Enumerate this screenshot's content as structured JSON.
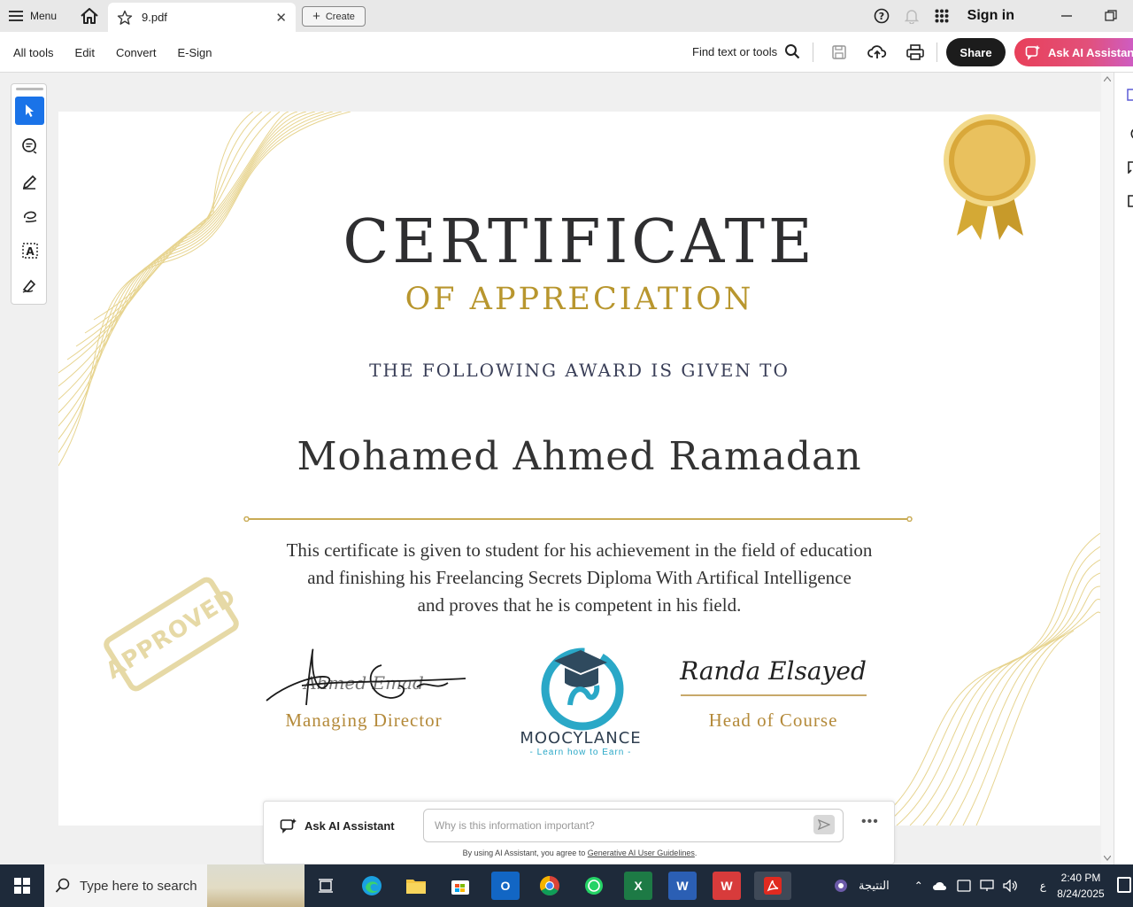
{
  "tabbar": {
    "menu_label": "Menu",
    "tab_title": "9.pdf",
    "create_label": "Create",
    "signin_label": "Sign in"
  },
  "toolbar": {
    "menu_items": [
      "All tools",
      "Edit",
      "Convert",
      "E-Sign"
    ],
    "find_label": "Find text or tools",
    "share_label": "Share",
    "ai_label": "Ask AI Assistant"
  },
  "certificate": {
    "title": "CERTIFICATE",
    "subtitle": "OF APPRECIATION",
    "given_to": "THE FOLLOWING AWARD IS GIVEN TO",
    "name": "Mohamed Ahmed Ramadan",
    "body_line1": "This certificate is given to student for his achievement in the field of education",
    "body_line2": "and finishing his Freelancing Secrets Diploma With Artifical Intelligence",
    "body_line3": "and proves that he is competent in his field.",
    "left_signature": "Ahmed Emad",
    "left_role": "Managing Director",
    "right_signature": "Randa Elsayed",
    "right_role": "Head of Course",
    "logo_name": "MOOCYLANCE",
    "logo_tagline": "- Learn how to Earn -",
    "stamp": "APPROVED"
  },
  "ai_panel": {
    "label": "Ask AI Assistant",
    "placeholder": "Why is this information important?",
    "disclaimer_prefix": "By using AI Assistant, you agree to",
    "disclaimer_link": "Generative AI User Guidelines",
    "disclaimer_suffix": "."
  },
  "taskbar": {
    "search_placeholder": "Type here to search",
    "tray_label": "النتيجة",
    "lang": "ع",
    "time": "2:40 PM",
    "date": "8/24/2025"
  },
  "colors": {
    "accent_blue": "#1a73e8",
    "gold": "#b8962e",
    "share_bg": "#1c1c1c",
    "ai_gradient_start": "#e8405a",
    "taskbar_bg": "#1e2a3a"
  }
}
